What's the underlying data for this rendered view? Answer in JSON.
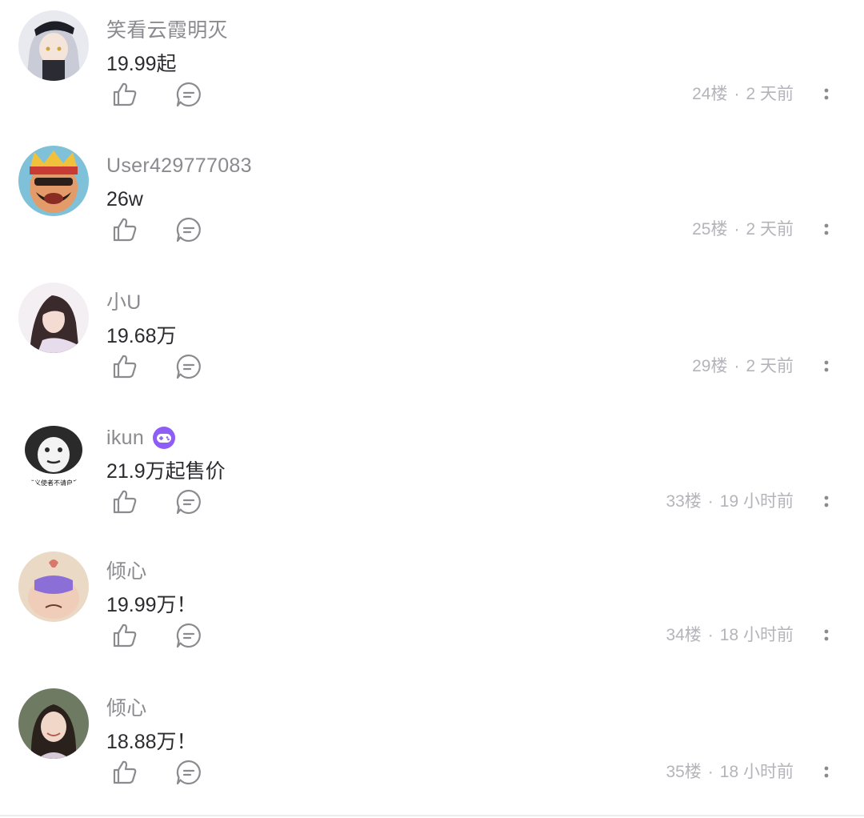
{
  "comments": [
    {
      "username": "笑看云霞明灭",
      "text": "19.99起",
      "floor": "24楼",
      "time": "2 天前",
      "has_badge": false,
      "avatar": "anime-girl-avatar"
    },
    {
      "username": "User429777083",
      "text": "26w",
      "floor": "25楼",
      "time": "2 天前",
      "has_badge": false,
      "avatar": "cartoon-king-avatar"
    },
    {
      "username": "小U",
      "text": "19.68万",
      "floor": "29楼",
      "time": "2 天前",
      "has_badge": false,
      "avatar": "illustrated-girl-avatar"
    },
    {
      "username": "ikun",
      "text": "21.9万起售价",
      "floor": "33楼",
      "time": "19 小时前",
      "has_badge": true,
      "avatar": "panda-meme-avatar",
      "avatar_text": "正义使者不请自来"
    },
    {
      "username": "倾心",
      "text": "19.99万！",
      "floor": "34楼",
      "time": "18 小时前",
      "has_badge": false,
      "avatar": "cartoon-sleeping-mask-avatar"
    },
    {
      "username": "倾心",
      "text": "18.88万！",
      "floor": "35楼",
      "time": "18 小时前",
      "has_badge": false,
      "avatar": "photo-woman-avatar"
    }
  ],
  "meta_separator": "·",
  "icons": {
    "like": "thumbs-up-icon",
    "reply": "comment-bubble-icon",
    "more": "more-vertical-icon",
    "badge": "game-controller-badge-icon"
  },
  "colors": {
    "username": "#8a8a8f",
    "content": "#2b2b2f",
    "meta": "#b4b4ba",
    "icon": "#8a8a8f",
    "badge": "#8e5cf7"
  }
}
